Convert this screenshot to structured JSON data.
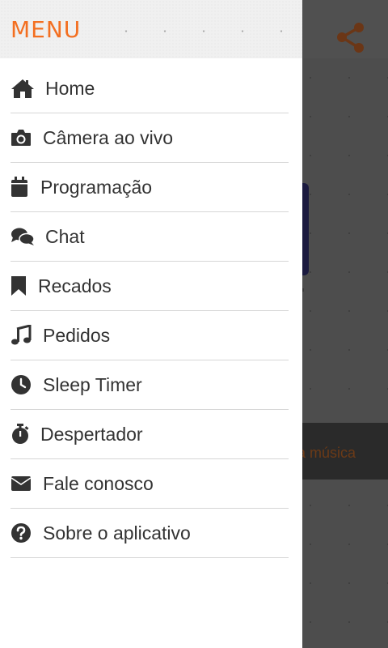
{
  "drawer": {
    "title": "MENU",
    "items": [
      {
        "label": "Home",
        "icon": "home-icon"
      },
      {
        "label": "Câmera ao vivo",
        "icon": "camera-icon"
      },
      {
        "label": "Programação",
        "icon": "calendar-icon"
      },
      {
        "label": "Chat",
        "icon": "chat-icon"
      },
      {
        "label": "Recados",
        "icon": "bookmark-icon"
      },
      {
        "label": "Pedidos",
        "icon": "music-icon"
      },
      {
        "label": "Sleep Timer",
        "icon": "clock-icon"
      },
      {
        "label": "Despertador",
        "icon": "stopwatch-icon"
      },
      {
        "label": "Fale conosco",
        "icon": "envelope-icon"
      },
      {
        "label": "Sobre o aplicativo",
        "icon": "question-icon"
      }
    ]
  },
  "background": {
    "share_icon": "share-icon",
    "playbar_text": "a música"
  },
  "colors": {
    "accent": "#f36f21",
    "text": "#333333",
    "divider": "#d6d6d6",
    "overlay": "#4d4d4d"
  }
}
